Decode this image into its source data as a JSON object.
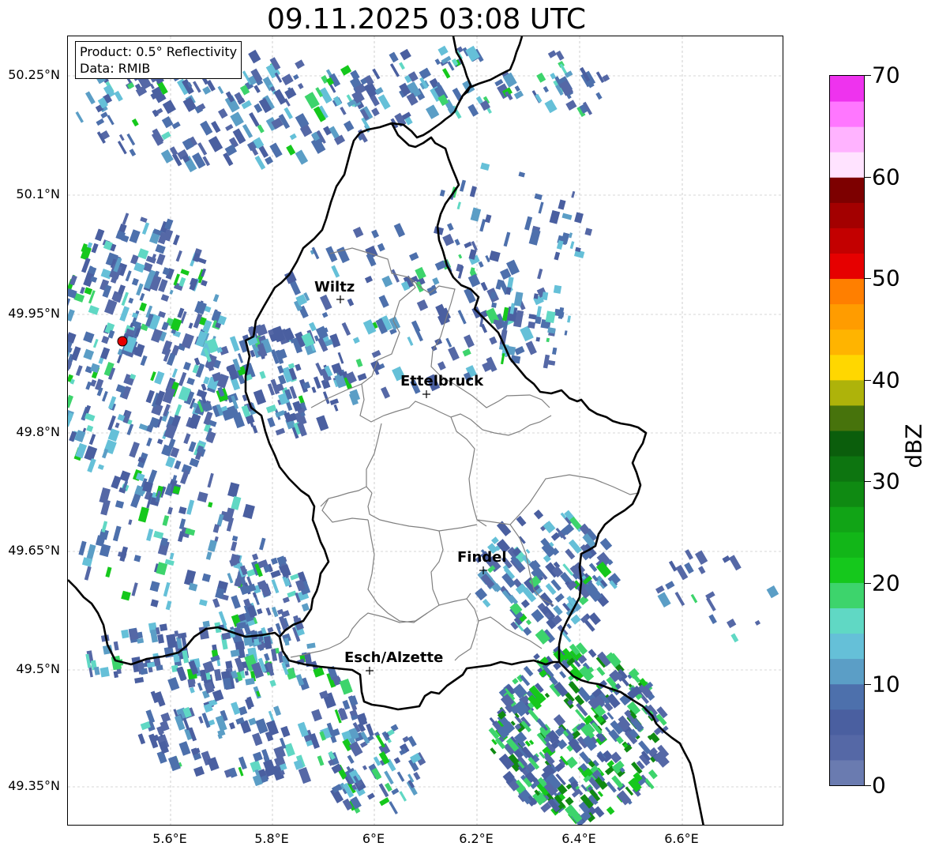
{
  "title": "09.11.2025 03:08 UTC",
  "info_box": {
    "product": "Product: 0.5° Reflectivity",
    "data": "Data: RMIB"
  },
  "lat_ticks": [
    "50.25°N",
    "50.1°N",
    "49.95°N",
    "49.8°N",
    "49.65°N",
    "49.5°N",
    "49.35°N"
  ],
  "lon_ticks": [
    "5.6°E",
    "5.8°E",
    "6°E",
    "6.2°E",
    "6.4°E",
    "6.6°E"
  ],
  "cities": [
    {
      "name": "Wiltz"
    },
    {
      "name": "Ettelbruck"
    },
    {
      "name": "Findel"
    },
    {
      "name": "Esch/Alzette"
    }
  ],
  "colorbar": {
    "label": "dBZ",
    "ticks": [
      "70",
      "60",
      "50",
      "40",
      "30",
      "20",
      "10",
      "0"
    ],
    "colors": [
      "#6a7bb0",
      "#5568a6",
      "#4a5fa0",
      "#4d70ac",
      "#5b9ec6",
      "#65c0d8",
      "#60d8c4",
      "#3dd46c",
      "#15c81c",
      "#12b618",
      "#11a416",
      "#0f8a12",
      "#0d7510",
      "#0b5e0c",
      "#47730c",
      "#aeb30a",
      "#ffd700",
      "#ffb400",
      "#ff9c00",
      "#ff7f00",
      "#e60000",
      "#c30000",
      "#a30000",
      "#7d0000",
      "#ffe3ff",
      "#ffb3ff",
      "#ff77ff",
      "#ee33ee"
    ]
  },
  "colors": {
    "border_national": "#000000",
    "border_canton": "#808080",
    "radar_site": "#e60000",
    "grid": "#b0b0b0"
  }
}
